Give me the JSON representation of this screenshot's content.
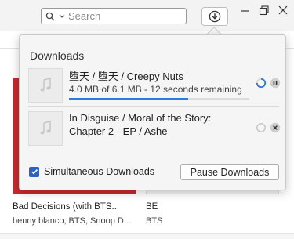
{
  "search": {
    "placeholder": "Search"
  },
  "toolbar": {
    "downloads_icon": "download-icon"
  },
  "library": {
    "albums": [
      {
        "title": "Bad Decisions (with BTS...",
        "artist": "benny blanco, BTS, Snoop D..."
      },
      {
        "title": "BE",
        "artist": "BTS"
      }
    ]
  },
  "downloads": {
    "title": "Downloads",
    "items": [
      {
        "title": "堕天 / 堕天 / Creepy Nuts",
        "status": "4.0 MB of 6.1 MB - 12 seconds remaining",
        "progress": 0.66,
        "state": "downloading"
      },
      {
        "title": "In Disguise / Moral of the Story: Chapter 2 - EP / Ashe",
        "status": "",
        "progress": 0,
        "state": "queued"
      }
    ],
    "simultaneous_label": "Simultaneous Downloads",
    "simultaneous_checked": true,
    "pause_label": "Pause Downloads"
  },
  "colors": {
    "accent": "#2a7ae2",
    "album_red": "#c62a2f"
  }
}
